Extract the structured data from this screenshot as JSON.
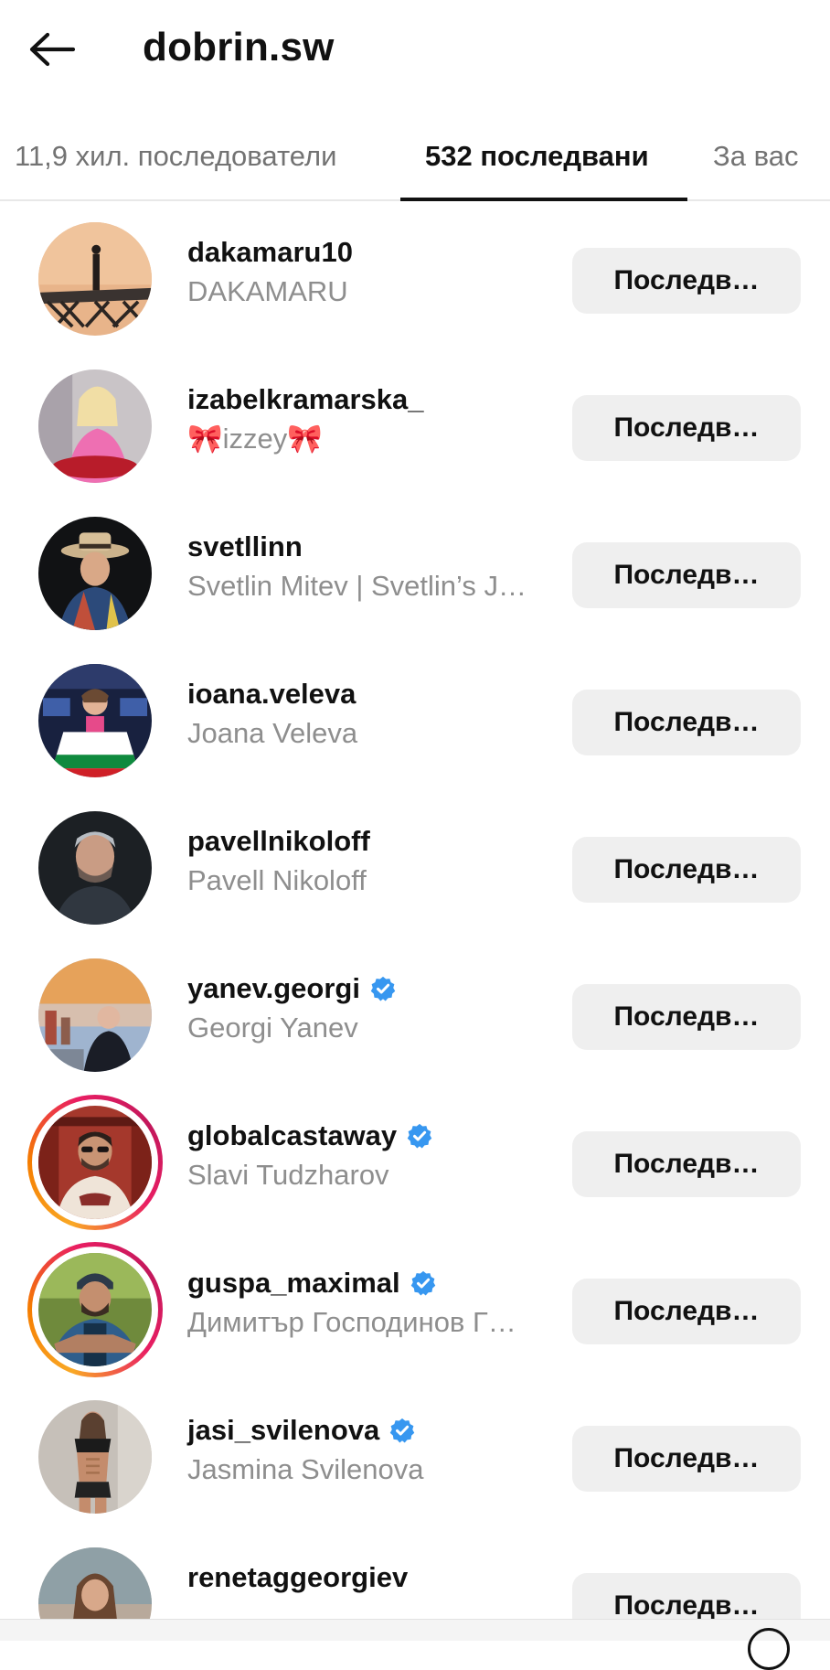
{
  "header": {
    "title": "dobrin.sw",
    "back_icon": "arrow-left-icon"
  },
  "tabs": [
    {
      "label": "11,9 хил. последователи",
      "active": false
    },
    {
      "label": "532 последвани",
      "active": true
    },
    {
      "label": "За вас",
      "active": false
    }
  ],
  "follow_label": "Последв…",
  "users": [
    {
      "username": "dakamaru10",
      "fullname": "DAKAMARU",
      "verified": false,
      "story": false
    },
    {
      "username": "izabelkramarska_",
      "fullname": "🎀izzey🎀",
      "verified": false,
      "story": false
    },
    {
      "username": "svetllinn",
      "fullname": "Svetlin Mitev | Svetlin’s J…",
      "verified": false,
      "story": false
    },
    {
      "username": "ioana.veleva",
      "fullname": "Joana Veleva",
      "verified": false,
      "story": false
    },
    {
      "username": "pavellnikoloff",
      "fullname": "Pavell Nikoloff",
      "verified": false,
      "story": false
    },
    {
      "username": "yanev.georgi",
      "fullname": "Georgi Yanev",
      "verified": true,
      "story": false
    },
    {
      "username": "globalcastaway",
      "fullname": "Slavi Tudzharov",
      "verified": true,
      "story": true
    },
    {
      "username": "guspa_maximal",
      "fullname": "Димитър Господинов Г…",
      "verified": true,
      "story": true
    },
    {
      "username": "jasi_svilenova",
      "fullname": "Jasmina Svilenova",
      "verified": true,
      "story": false
    },
    {
      "username": "renetaggeorgiev",
      "fullname": "",
      "verified": false,
      "story": false
    }
  ],
  "colors": {
    "verified_blue": "#3797f0",
    "button_bg": "#efefef",
    "secondary_text": "#8e8e8e"
  }
}
